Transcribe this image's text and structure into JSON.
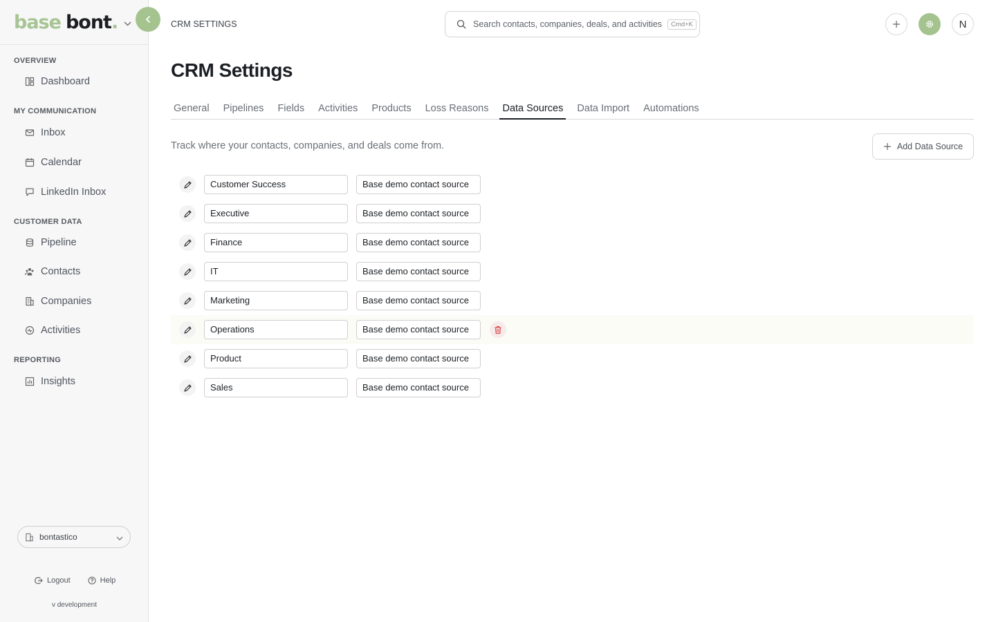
{
  "sidebar": {
    "logo_part1": "base",
    "logo_part2": "bont",
    "logo_dot": ".",
    "sections": [
      {
        "title": "OVERVIEW",
        "items": [
          {
            "label": "Dashboard",
            "icon": "dashboard-icon"
          }
        ]
      },
      {
        "title": "MY COMMUNICATION",
        "items": [
          {
            "label": "Inbox",
            "icon": "mail-icon"
          },
          {
            "label": "Calendar",
            "icon": "calendar-icon"
          },
          {
            "label": "LinkedIn Inbox",
            "icon": "chat-icon"
          }
        ]
      },
      {
        "title": "CUSTOMER DATA",
        "items": [
          {
            "label": "Pipeline",
            "icon": "database-icon"
          },
          {
            "label": "Contacts",
            "icon": "users-icon"
          },
          {
            "label": "Companies",
            "icon": "building-icon"
          },
          {
            "label": "Activities",
            "icon": "activity-icon"
          }
        ]
      },
      {
        "title": "REPORTING",
        "items": [
          {
            "label": "Insights",
            "icon": "chart-icon"
          }
        ]
      }
    ],
    "workspace": "bontastico",
    "logout": "Logout",
    "help": "Help",
    "version": "v development"
  },
  "header": {
    "breadcrumb": "CRM SETTINGS",
    "search_placeholder": "Search contacts, companies, deals, and activities",
    "search_shortcut": "Cmd+K",
    "avatar_initial": "N"
  },
  "page": {
    "title": "CRM Settings",
    "tabs": [
      "General",
      "Pipelines",
      "Fields",
      "Activities",
      "Products",
      "Loss Reasons",
      "Data Sources",
      "Data Import",
      "Automations"
    ],
    "active_tab": "Data Sources",
    "description": "Track where your contacts, companies, and deals come from.",
    "add_button": "Add Data Source"
  },
  "data_sources": [
    {
      "name": "Customer Success",
      "description": "Base demo contact source"
    },
    {
      "name": "Executive",
      "description": "Base demo contact source"
    },
    {
      "name": "Finance",
      "description": "Base demo contact source"
    },
    {
      "name": "IT",
      "description": "Base demo contact source"
    },
    {
      "name": "Marketing",
      "description": "Base demo contact source"
    },
    {
      "name": "Operations",
      "description": "Base demo contact source"
    },
    {
      "name": "Product",
      "description": "Base demo contact source"
    },
    {
      "name": "Sales",
      "description": "Base demo contact source"
    }
  ],
  "colors": {
    "accent": "#a4c38f",
    "danger": "#d9534f"
  }
}
